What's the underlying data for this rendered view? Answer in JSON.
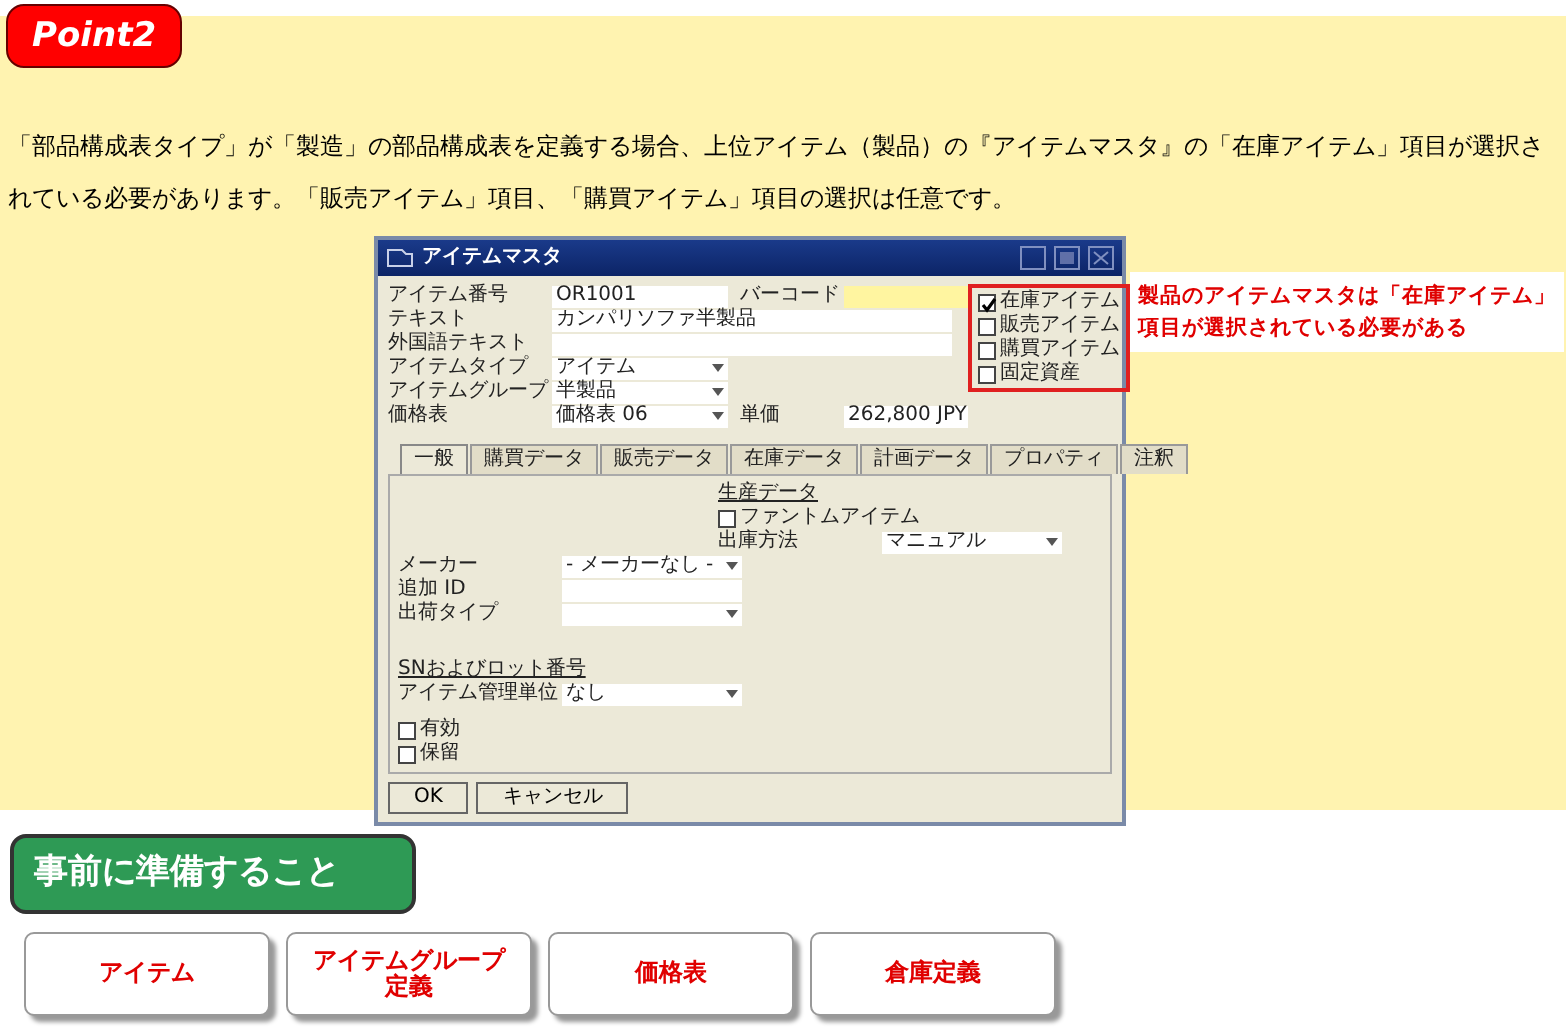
{
  "badge": "Point2",
  "paragraph": "「部品構成表タイプ」が「製造」の部品構成表を定義する場合、上位アイテム（製品）の『アイテムマスタ』の「在庫アイテム」項目が選択されている必要があります。「販売アイテム」項目、「購買アイテム」項目の選択は任意です。",
  "window": {
    "title": "アイテムマスタ",
    "top_fields": [
      {
        "label": "アイテム番号",
        "value": "OR1001",
        "kind": "text",
        "side": {
          "label": "バーコード",
          "kind": "highlight"
        }
      },
      {
        "label": "テキスト",
        "value": "カンパリソファ半製品",
        "kind": "wide"
      },
      {
        "label": "外国語テキスト",
        "kind": "wide"
      },
      {
        "label": "アイテムタイプ",
        "value": "アイテム",
        "kind": "dropdown"
      },
      {
        "label": "アイテムグループ",
        "value": "半製品",
        "kind": "dropdown"
      },
      {
        "label": "価格表",
        "value": "価格表 06",
        "kind": "dropdown",
        "side": {
          "label": "単価",
          "value": "262,800 JPY",
          "kind": "text"
        }
      }
    ],
    "item_checks": [
      {
        "label": "在庫アイテム",
        "checked": true
      },
      {
        "label": "販売アイテム",
        "checked": false
      },
      {
        "label": "購買アイテム",
        "checked": false
      },
      {
        "label": "固定資産",
        "checked": false
      }
    ],
    "tabs": [
      {
        "label": "一般",
        "selected": true
      },
      {
        "label": "購買データ",
        "selected": false
      },
      {
        "label": "販売データ",
        "selected": false
      },
      {
        "label": "在庫データ",
        "selected": false
      },
      {
        "label": "計画データ",
        "selected": false
      },
      {
        "label": "プロパティ",
        "selected": false
      },
      {
        "label": "注釈",
        "selected": false
      }
    ],
    "production": {
      "header": "生産データ",
      "phantom": {
        "label": "ファントムアイテム",
        "checked": false
      },
      "issue": {
        "label": "出庫方法",
        "value": "マニュアル",
        "kind": "dropdown"
      }
    },
    "general_fields": [
      {
        "label": "メーカー",
        "value": "- メーカーなし -",
        "kind": "dropdown"
      },
      {
        "label": "追加 ID",
        "kind": "text"
      },
      {
        "label": "出荷タイプ",
        "kind": "dropdown"
      }
    ],
    "sn_header": "SNおよびロット番号",
    "sn_fields": [
      {
        "label": "アイテム管理単位",
        "value": "なし",
        "kind": "dropdown"
      }
    ],
    "status_checks": [
      {
        "label": "有効",
        "checked": false
      },
      {
        "label": "保留",
        "checked": false
      }
    ],
    "buttons": [
      "OK",
      "キャンセル"
    ]
  },
  "callout": [
    "製品のアイテムマスタは「在庫アイテム」",
    "項目が選択されている必要がある"
  ],
  "prep": {
    "title": "事前に準備すること",
    "buttons": [
      {
        "lines": [
          "アイテム"
        ]
      },
      {
        "lines": [
          "アイテムグループ",
          "定義"
        ]
      },
      {
        "lines": [
          "価格表"
        ]
      },
      {
        "lines": [
          "倉庫定義"
        ]
      }
    ]
  }
}
